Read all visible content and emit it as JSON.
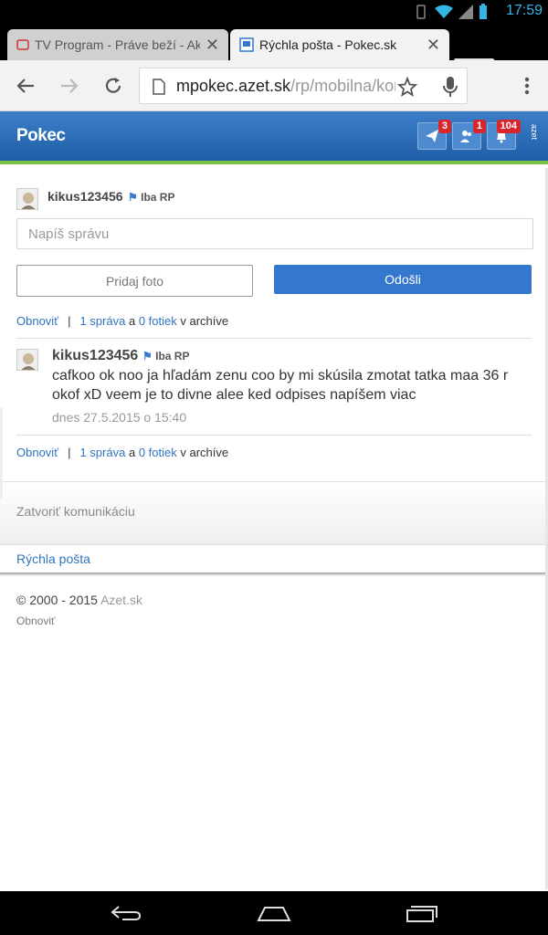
{
  "status": {
    "time": "17:59"
  },
  "tabs": [
    {
      "title": "TV Program - Práve beží - Akt",
      "close": "✕"
    },
    {
      "title": "Rýchla pošta - Pokec.sk",
      "close": "✕"
    }
  ],
  "omnibox": {
    "host": "mpokec.azet.sk",
    "path": "/rp/mobilna/kontext"
  },
  "header": {
    "logo": "Pokec",
    "badges": {
      "messages": "3",
      "friends": "1",
      "notifications": "104"
    },
    "azet": "azet"
  },
  "conversation": {
    "user": "kikus123456",
    "rp_label": "Iba RP",
    "input_placeholder": "Napíš správu",
    "add_photo": "Pridaj foto",
    "send": "Odošli",
    "refresh": "Obnoviť",
    "archive_count": "1 správa",
    "archive_a": "a",
    "photo_count": "0 fotiek",
    "archive_suffix": "v archíve",
    "message": {
      "user": "kikus123456",
      "rp_label": "Iba RP",
      "text": "cafkoo  ok noo ja hľadám zenu coo by mi skúsila zmotat tatka  maa 36 r okof xD veem je to divne alee ked odpises napíšem viac",
      "date": "dnes 27.5.2015 o 15:40"
    },
    "close_communication": "Zatvoriť komunikáciu",
    "quick_mail": "Rýchla pošta"
  },
  "footer": {
    "copyright": "© 2000 - 2015",
    "brand": "Azet.sk",
    "refresh": "Obnoviť"
  }
}
